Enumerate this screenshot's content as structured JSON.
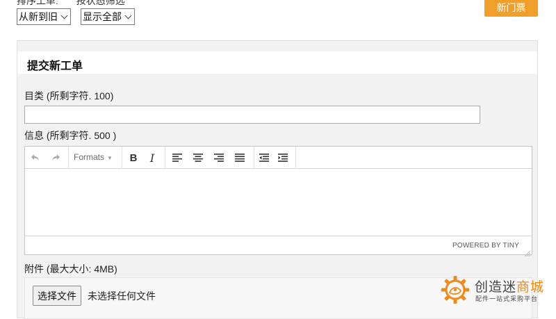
{
  "filter_bar": {
    "sort_label": "排序工单:",
    "status_label": "按状态筛选",
    "sort_select": {
      "value": "从新到旧"
    },
    "status_select": {
      "value": "显示全部"
    }
  },
  "header": {
    "new_ticket_label": "新门票"
  },
  "panel": {
    "title": "提交新工单",
    "subject": {
      "label": "目类 (所剩字符. 100)",
      "value": ""
    },
    "message": {
      "label": "信息 (所剩字符. 500 )"
    },
    "editor": {
      "formats_label": "Formats",
      "powered_by": "POWERED BY TINY"
    },
    "attachment": {
      "label": "附件 (最大大小: 4MB)",
      "button_label": "选择文件",
      "status": "未选择任何文件"
    }
  },
  "logo": {
    "name_main": "创造迷",
    "name_accent": "商城",
    "tagline": "配件一站式采购平台"
  },
  "colors": {
    "accent": "#f0a028",
    "panel_bg": "#f2f2f2",
    "logo_accent": "#f08a1c"
  },
  "icons": [
    "undo-icon",
    "redo-icon",
    "bold-icon",
    "italic-icon",
    "align-left-icon",
    "align-center-icon",
    "align-right-icon",
    "align-justify-icon",
    "outdent-icon",
    "indent-icon",
    "resize-handle-icon",
    "gear-logo-icon"
  ]
}
